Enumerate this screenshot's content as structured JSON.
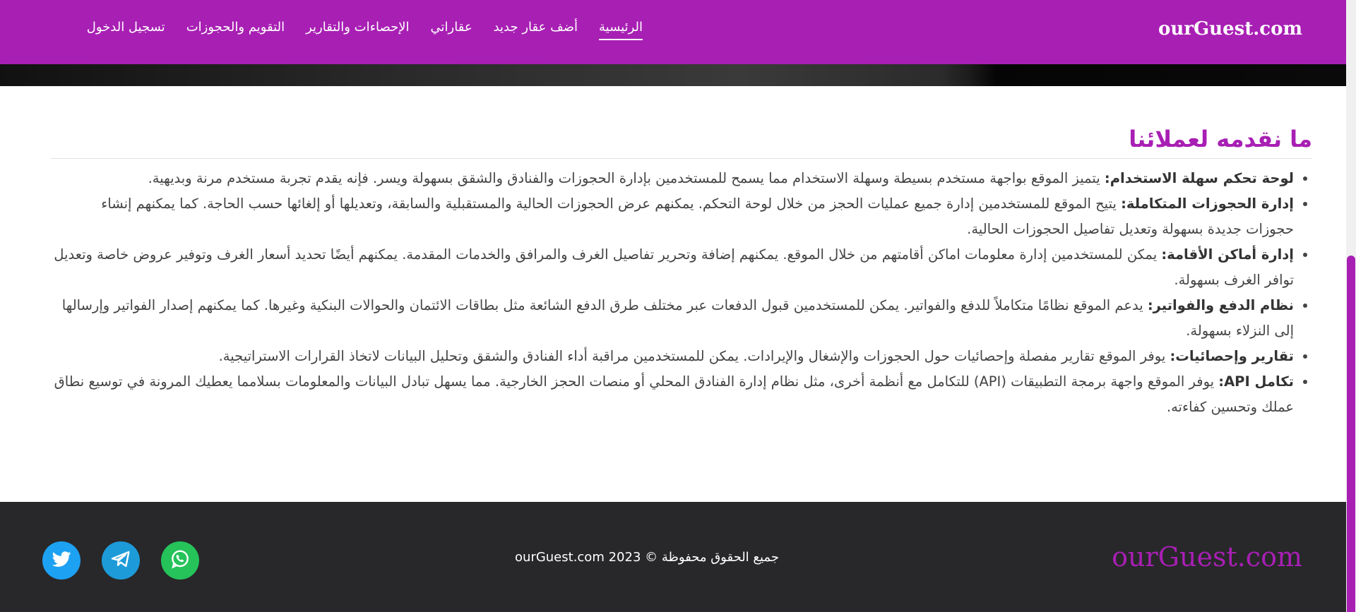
{
  "navbar": {
    "brand": "ourGuest.com",
    "links": [
      {
        "label": "الرئيسية",
        "active": true
      },
      {
        "label": "أضف عقار جديد",
        "active": false
      },
      {
        "label": "عقاراتي",
        "active": false
      },
      {
        "label": "الإحصاءات والتقارير",
        "active": false
      },
      {
        "label": "التقويم والحجوزات",
        "active": false
      },
      {
        "label": "تسجيل الدخول",
        "active": false
      }
    ]
  },
  "main": {
    "section_title": "ما نقدمه لعملائنا",
    "features": [
      {
        "title": "لوحة تحكم سهلة الاستخدام:",
        "text": " يتميز الموقع بواجهة مستخدم بسيطة وسهلة الاستخدام مما يسمح للمستخدمين بإدارة الحجوزات والفنادق والشقق بسهولة ويسر. فإنه يقدم تجربة مستخدم مرنة وبديهية."
      },
      {
        "title": "إدارة الحجوزات المتكاملة:",
        "text": " يتيح الموقع للمستخدمين إدارة جميع عمليات الحجز من خلال لوحة التحكم. يمكنهم عرض الحجوزات الحالية والمستقبلية والسابقة، وتعديلها أو إلغائها حسب الحاجة. كما يمكنهم إنشاء حجوزات جديدة بسهولة وتعديل تفاصيل الحجوزات الحالية."
      },
      {
        "title": "إدارة أماكن الأقامة:",
        "text": " يمكن للمستخدمين إدارة معلومات اماكن أقامتهم من خلال الموقع. يمكنهم إضافة وتحرير تفاصيل الغرف والمرافق والخدمات المقدمة. يمكنهم أيضًا تحديد أسعار الغرف وتوفير عروض خاصة وتعديل توافر الغرف بسهولة."
      },
      {
        "title": "نظام الدفع والفواتير:",
        "text": " يدعم الموقع نظامًا متكاملاً للدفع والفواتير. يمكن للمستخدمين قبول الدفعات عبر مختلف طرق الدفع الشائعة مثل بطاقات الائتمان والحوالات البنكية وغيرها. كما يمكنهم إصدار الفواتير وإرسالها إلى النزلاء بسهولة."
      },
      {
        "title": "تقارير وإحصائيات:",
        "text": " يوفر الموقع تقارير مفصلة وإحصائيات حول الحجوزات والإشغال والإيرادات. يمكن للمستخدمين مراقبة أداء الفنادق والشقق وتحليل البيانات لاتخاذ القرارات الاستراتيجية."
      },
      {
        "title": "تكامل API:",
        "text": " يوفر الموقع واجهة برمجة التطبيقات (API) للتكامل مع أنظمة أخرى، مثل نظام إدارة الفنادق المحلي أو منصات الحجز الخارجية. مما يسهل تبادل البيانات والمعلومات بسلامما يعطيك المرونة في توسيع نطاق عملك وتحسين كفاءته."
      }
    ]
  },
  "footer": {
    "brand": "ourGuest.com",
    "copyright": "جميع الحقوق محفوظة © 2023 ourGuest.com",
    "social": [
      {
        "icon": "twitter-icon",
        "color": "#1da1f2"
      },
      {
        "icon": "telegram-icon",
        "color": "#1d9bd9"
      },
      {
        "icon": "whatsapp-icon",
        "color": "#25c35a"
      }
    ]
  },
  "colors": {
    "brand_purple": "#a81fb4",
    "footer_bg": "#28282a"
  }
}
